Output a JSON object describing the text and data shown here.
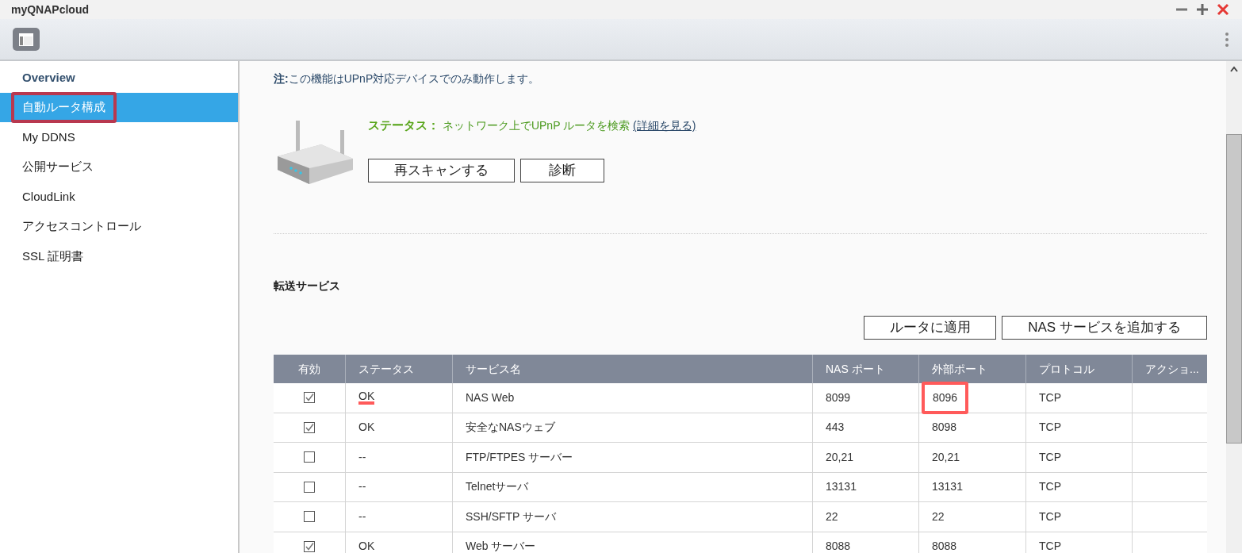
{
  "window": {
    "title": "myQNAPcloud"
  },
  "sidebar": {
    "items": [
      {
        "label": "Overview",
        "selected": false,
        "annotated": false,
        "kind": "heading"
      },
      {
        "label": "自動ルータ構成",
        "selected": true,
        "annotated": true,
        "kind": "item"
      },
      {
        "label": "My DDNS",
        "selected": false,
        "annotated": false,
        "kind": "item"
      },
      {
        "label": "公開サービス",
        "selected": false,
        "annotated": false,
        "kind": "item"
      },
      {
        "label": "CloudLink",
        "selected": false,
        "annotated": false,
        "kind": "item"
      },
      {
        "label": "アクセスコントロール",
        "selected": false,
        "annotated": false,
        "kind": "item"
      },
      {
        "label": "SSL 証明書",
        "selected": false,
        "annotated": false,
        "kind": "item"
      }
    ]
  },
  "note": {
    "label": "注:",
    "text": "この機能はUPnP対応デバイスでのみ動作します。"
  },
  "status": {
    "label": "ステータス：",
    "text": "ネットワーク上でUPnP ルータを検索",
    "link": "(詳細を見る)"
  },
  "router_buttons": [
    "再スキャンする",
    "診断"
  ],
  "section_title": "転送サービス",
  "table_buttons": [
    "ルータに適用",
    "NAS サービスを追加する"
  ],
  "table": {
    "columns": [
      "有効",
      "ステータス",
      "サービス名",
      "NAS ポート",
      "外部ポート",
      "プロトコル",
      "アクショ..."
    ],
    "rows": [
      {
        "checked": true,
        "status": "OK",
        "name": "NAS Web",
        "nas_port": "8099",
        "ext_port": "8096",
        "protocol": "TCP",
        "status_underlined": true,
        "ext_port_boxed": true
      },
      {
        "checked": true,
        "status": "OK",
        "name": "安全なNASウェブ",
        "nas_port": "443",
        "ext_port": "8098",
        "protocol": "TCP",
        "status_underlined": false,
        "ext_port_boxed": false
      },
      {
        "checked": false,
        "status": "--",
        "name": "FTP/FTPES サーバー",
        "nas_port": "20,21",
        "ext_port": "20,21",
        "protocol": "TCP",
        "status_underlined": false,
        "ext_port_boxed": false
      },
      {
        "checked": false,
        "status": "--",
        "name": "Telnetサーバ",
        "nas_port": "13131",
        "ext_port": "13131",
        "protocol": "TCP",
        "status_underlined": false,
        "ext_port_boxed": false
      },
      {
        "checked": false,
        "status": "--",
        "name": "SSH/SFTP サーバ",
        "nas_port": "22",
        "ext_port": "22",
        "protocol": "TCP",
        "status_underlined": false,
        "ext_port_boxed": false
      },
      {
        "checked": true,
        "status": "OK",
        "name": "Web サーバー",
        "nas_port": "8088",
        "ext_port": "8088",
        "protocol": "TCP",
        "status_underlined": false,
        "ext_port_boxed": false
      }
    ]
  }
}
